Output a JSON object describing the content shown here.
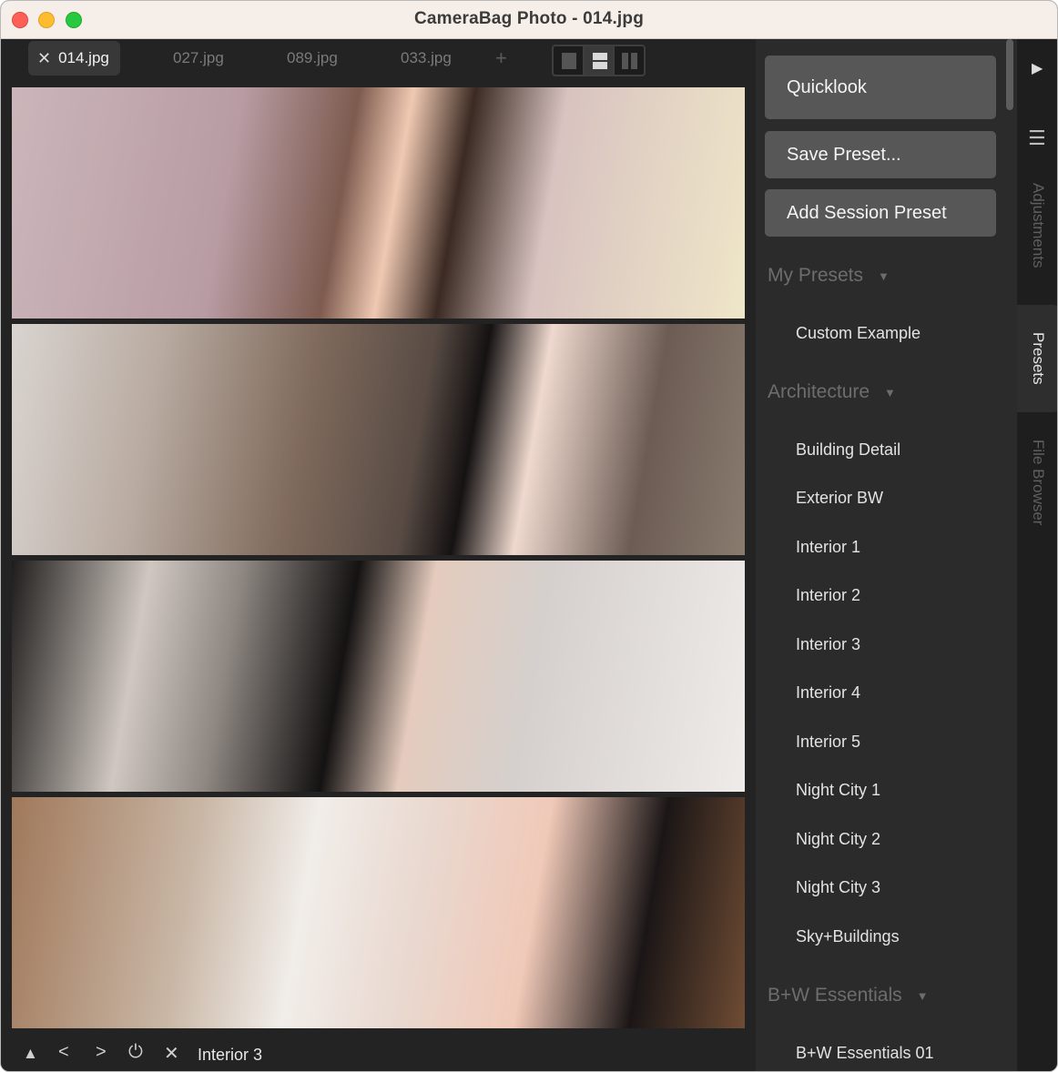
{
  "window": {
    "title": "CameraBag Photo - 014.jpg"
  },
  "tabs": [
    {
      "label": "014.jpg",
      "active": true
    },
    {
      "label": "027.jpg",
      "active": false
    },
    {
      "label": "089.jpg",
      "active": false
    },
    {
      "label": "033.jpg",
      "active": false
    }
  ],
  "toolbar": {
    "add_tab": "+",
    "layout_selected": "rows"
  },
  "bottom": {
    "status": "Interior 3"
  },
  "panel": {
    "quicklook": "Quicklook",
    "save_preset": "Save Preset...",
    "add_session_preset": "Add Session Preset",
    "groups": [
      {
        "title": "My Presets",
        "items": [
          "Custom Example"
        ]
      },
      {
        "title": "Architecture",
        "items": [
          "Building Detail",
          "Exterior BW",
          "Interior 1",
          "Interior 2",
          "Interior 3",
          "Interior 4",
          "Interior 5",
          "Night City 1",
          "Night City 2",
          "Night City 3",
          "Sky+Buildings"
        ]
      },
      {
        "title": "B+W Essentials",
        "items": [
          "B+W Essentials 01"
        ]
      }
    ]
  },
  "rail": {
    "tabs": [
      {
        "label": "Adjustments",
        "active": false
      },
      {
        "label": "Presets",
        "active": true
      },
      {
        "label": "File Browser",
        "active": false
      }
    ]
  },
  "icons": {
    "close_tab": "close-icon",
    "play": "play-icon",
    "menu": "hamburger-icon",
    "up": "triangle-up-icon",
    "prev": "chevron-left-icon",
    "next": "chevron-right-icon",
    "power": "power-icon",
    "remove": "close-icon",
    "expand": "triangle-down-icon"
  }
}
